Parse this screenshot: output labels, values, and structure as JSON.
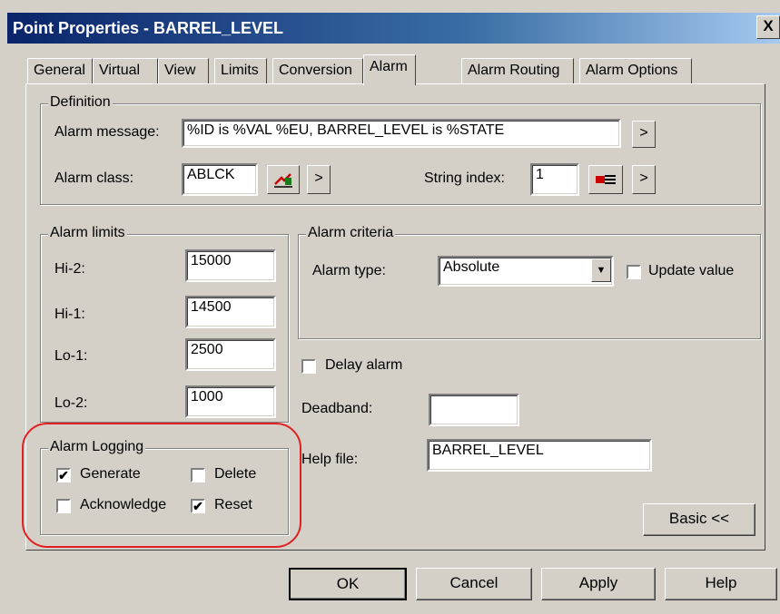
{
  "window": {
    "title": "Point Properties - BARREL_LEVEL",
    "close_label": "X"
  },
  "tabs": [
    {
      "label": "General"
    },
    {
      "label": "Virtual"
    },
    {
      "label": "View"
    },
    {
      "label": "Limits"
    },
    {
      "label": "Conversion"
    },
    {
      "label": "Alarm",
      "active": true
    },
    {
      "label": "Alarm Routing"
    },
    {
      "label": "Alarm Options"
    }
  ],
  "definition": {
    "title": "Definition",
    "alarm_message_label": "Alarm message:",
    "alarm_message_value": "%ID is %VAL %EU, BARREL_LEVEL is %STATE",
    "alarm_class_label": "Alarm class:",
    "alarm_class_value": "ABLCK",
    "string_index_label": "String index:",
    "string_index_value": "1",
    "more_label": ">"
  },
  "alarm_limits": {
    "title": "Alarm limits",
    "items": [
      {
        "label": "Hi-2:",
        "value": "15000"
      },
      {
        "label": "Hi-1:",
        "value": "14500"
      },
      {
        "label": "Lo-1:",
        "value": "2500"
      },
      {
        "label": "Lo-2:",
        "value": "1000"
      }
    ]
  },
  "alarm_criteria": {
    "title": "Alarm criteria",
    "alarm_type_label": "Alarm type:",
    "alarm_type_value": "Absolute",
    "update_value_label": "Update value",
    "update_value_checked": false
  },
  "delay_alarm": {
    "label": "Delay alarm",
    "checked": false
  },
  "deadband": {
    "label": "Deadband:",
    "value": ""
  },
  "help_file": {
    "label": "Help file:",
    "value": "BARREL_LEVEL"
  },
  "alarm_logging": {
    "title": "Alarm Logging",
    "generate": {
      "label": "Generate",
      "checked": true
    },
    "delete": {
      "label": "Delete",
      "checked": false
    },
    "acknowledge": {
      "label": "Acknowledge",
      "checked": false
    },
    "reset": {
      "label": "Reset",
      "checked": true
    }
  },
  "basic_button": "Basic <<",
  "buttons": {
    "ok": "OK",
    "cancel": "Cancel",
    "apply": "Apply",
    "help": "Help"
  },
  "checkmark": "✔",
  "highlight_color": "#e02020"
}
